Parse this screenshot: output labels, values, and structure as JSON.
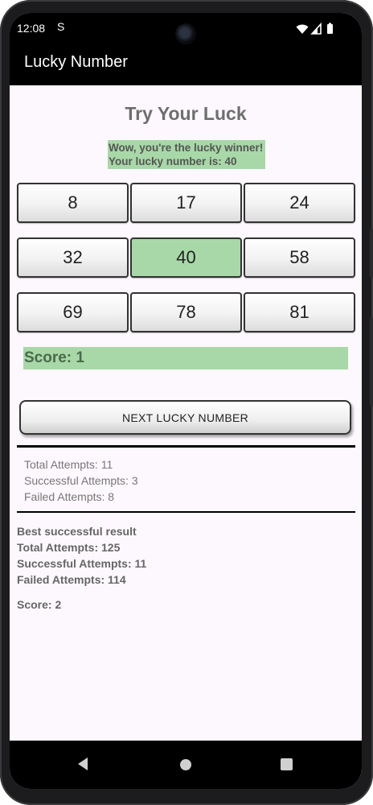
{
  "status_bar": {
    "time": "12:08",
    "indicator": "S"
  },
  "app_bar": {
    "title": "Lucky Number"
  },
  "main": {
    "title": "Try Your Luck",
    "winner_message": {
      "line1": "Wow, you're the lucky winner!",
      "line2": "Your lucky number is: 40"
    },
    "numbers": [
      "8",
      "17",
      "24",
      "32",
      "40",
      "58",
      "69",
      "78",
      "81"
    ],
    "selected_number": "40",
    "score": "Score: 1",
    "next_button_label": "NEXT LUCKY NUMBER"
  },
  "current_stats": {
    "total": "Total Attempts: 11",
    "successful": "Successful Attempts: 3",
    "failed": "Failed Attempts:  8"
  },
  "best_result": {
    "heading": "Best successful result",
    "total": "Total Attempts: 125",
    "successful": "Successful Attempts: 11",
    "failed": "Failed Attempts:  114",
    "score": "Score: 2"
  },
  "icons": {
    "wifi": "wifi-icon",
    "signal": "signal-icon",
    "battery": "battery-icon",
    "nav_back": "back-icon",
    "nav_home": "home-icon",
    "nav_recents": "recents-icon"
  },
  "colors": {
    "highlight_green": "#a8d8a8",
    "app_bar": "#000000",
    "background": "#fdf8fd"
  }
}
